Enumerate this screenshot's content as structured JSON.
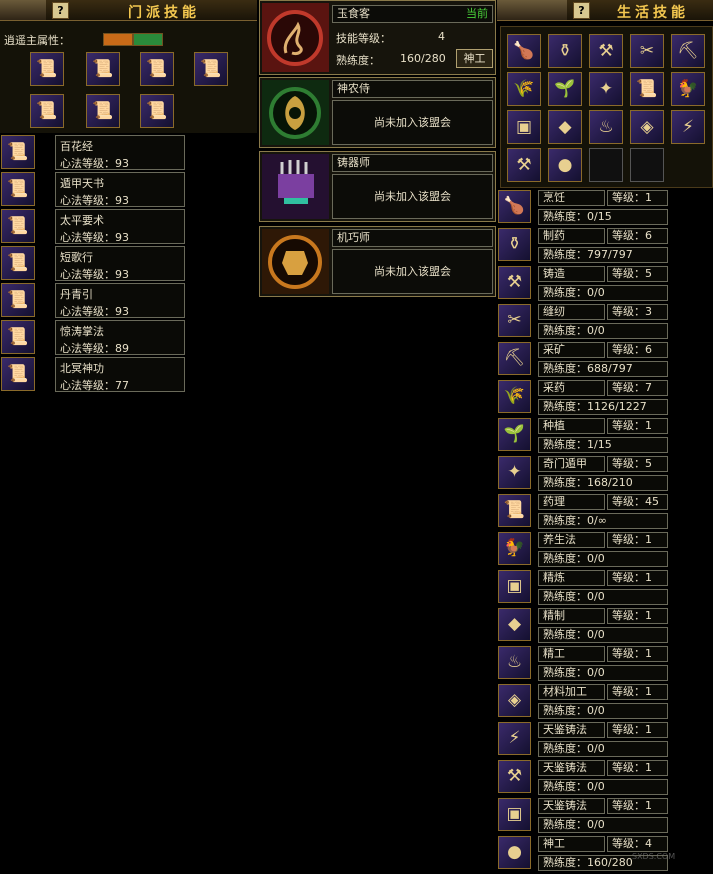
{
  "sect": {
    "title": "门派技能",
    "help": "?",
    "attr_label": "逍遥主属性：",
    "colors": {
      "fire": "#c86a18",
      "wood": "#2a8a3a"
    },
    "grid_icons": [
      "book-icon",
      "book-icon",
      "book-icon",
      "book-icon",
      "book-icon",
      "book-icon",
      "book-icon"
    ],
    "skills": [
      {
        "name": "百花经",
        "level": "心法等级：93",
        "icon": "book-icon"
      },
      {
        "name": "遁甲天书",
        "level": "心法等级：93",
        "icon": "book-icon"
      },
      {
        "name": "太平要术",
        "level": "心法等级：93",
        "icon": "book-icon"
      },
      {
        "name": "短歌行",
        "level": "心法等级：93",
        "icon": "book-icon"
      },
      {
        "name": "丹青引",
        "level": "心法等级：93",
        "icon": "book-icon"
      },
      {
        "name": "惊涛掌法",
        "level": "心法等级：89",
        "icon": "book-icon"
      },
      {
        "name": "北冥神功",
        "level": "心法等级：77",
        "icon": "book-icon"
      }
    ]
  },
  "guilds": {
    "first": {
      "name": "玉食客",
      "status": "当前",
      "skill_level_label": "技能等级：",
      "skill_level_value": "4",
      "proficiency_label": "熟练度：",
      "proficiency_value": "160/280",
      "title_button": "神工",
      "emblem": "dragon-emblem-icon",
      "color": "#c0392b"
    },
    "others": [
      {
        "name": "神农侍",
        "status": "尚未加入该盟会",
        "emblem": "leaf-emblem-icon",
        "color": "#2e7d32"
      },
      {
        "name": "铸器师",
        "status": "尚未加入该盟会",
        "emblem": "forge-emblem-icon",
        "color": "#7b3fa0"
      },
      {
        "name": "机巧师",
        "status": "尚未加入该盟会",
        "emblem": "gear-emblem-icon",
        "color": "#c8781e"
      }
    ]
  },
  "life": {
    "title": "生活技能",
    "help": "?",
    "grid_icons": [
      "roast-chicken-icon",
      "cauldron-icon",
      "anvil-icon",
      "sewing-icon",
      "pickaxe-icon",
      "harvest-icon",
      "sprout-icon",
      "dancer-icon",
      "scroll-icon",
      "rooster-icon",
      "chest-icon",
      "fire-gem-icon",
      "dragon-icon",
      "red-chest-icon",
      "blue-anvil-icon",
      "hammer-icon",
      "orbs-icon",
      "empty-slot",
      "empty-slot"
    ],
    "skills": [
      {
        "name": "烹饪",
        "level": "等级：1",
        "prof": "熟练度：0/15",
        "icon": "roast-chicken-icon"
      },
      {
        "name": "制药",
        "level": "等级：6",
        "prof": "熟练度：797/797",
        "icon": "cauldron-icon"
      },
      {
        "name": "铸造",
        "level": "等级：5",
        "prof": "熟练度：0/0",
        "icon": "anvil-icon"
      },
      {
        "name": "缝纫",
        "level": "等级：3",
        "prof": "熟练度：0/0",
        "icon": "sewing-icon"
      },
      {
        "name": "采矿",
        "level": "等级：6",
        "prof": "熟练度：688/797",
        "icon": "pickaxe-icon"
      },
      {
        "name": "采药",
        "level": "等级：7",
        "prof": "熟练度：1126/1227",
        "icon": "harvest-icon"
      },
      {
        "name": "种植",
        "level": "等级：1",
        "prof": "熟练度：1/15",
        "icon": "sprout-icon"
      },
      {
        "name": "奇门遁甲",
        "level": "等级：5",
        "prof": "熟练度：168/210",
        "icon": "dancer-icon"
      },
      {
        "name": "药理",
        "level": "等级：45",
        "prof": "熟练度：0/∞",
        "icon": "scroll-icon"
      },
      {
        "name": "养生法",
        "level": "等级：1",
        "prof": "熟练度：0/0",
        "icon": "rooster-icon"
      },
      {
        "name": "精炼",
        "level": "等级：1",
        "prof": "熟练度：0/0",
        "icon": "chest-icon"
      },
      {
        "name": "精制",
        "level": "等级：1",
        "prof": "熟练度：0/0",
        "icon": "fire-gem-icon"
      },
      {
        "name": "精工",
        "level": "等级：1",
        "prof": "熟练度：0/0",
        "icon": "dragon-icon"
      },
      {
        "name": "材料加工",
        "level": "等级：1",
        "prof": "熟练度：0/0",
        "icon": "red-chest-icon"
      },
      {
        "name": "天鉴铸法",
        "level": "等级：1",
        "prof": "熟练度：0/0",
        "icon": "blue-anvil-icon"
      },
      {
        "name": "天鉴铸法",
        "level": "等级：1",
        "prof": "熟练度：0/0",
        "icon": "hammer-icon"
      },
      {
        "name": "天鉴铸法",
        "level": "等级：1",
        "prof": "熟练度：0/0",
        "icon": "chest-icon"
      },
      {
        "name": "神工",
        "level": "等级：4",
        "prof": "熟练度：160/280",
        "icon": "orbs-icon"
      }
    ]
  },
  "watermark": "SXDS.COM"
}
